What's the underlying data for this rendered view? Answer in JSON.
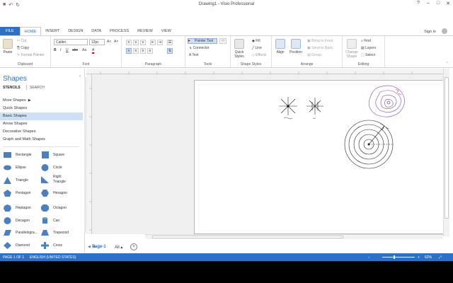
{
  "window": {
    "title": "Drawing1 - Visio Professional",
    "controls": [
      "?",
      "–",
      "□",
      "✕"
    ],
    "signin": "Sign in"
  },
  "qat": {
    "save": "■",
    "undo": "↶",
    "redo": "↻"
  },
  "tabs": [
    "FILE",
    "HOME",
    "INSERT",
    "DESIGN",
    "DATA",
    "PROCESS",
    "REVIEW",
    "VIEW"
  ],
  "ribbon": {
    "clipboard": {
      "label": "Clipboard",
      "paste": "Paste",
      "cut": "Cut",
      "copy": "Copy",
      "format_painter": "Format Painter"
    },
    "font": {
      "label": "Font",
      "family": "Calibri",
      "size": "12pt.",
      "grow": "A˄",
      "shrink": "A˅",
      "bold": "B",
      "italic": "I",
      "underline": "U",
      "strike": "abc",
      "aa": "Aa",
      "color": "A"
    },
    "paragraph": {
      "label": "Paragraph"
    },
    "tools": {
      "label": "Tools",
      "pointer": "Pointer Tool",
      "connector": "Connector",
      "text": "Text"
    },
    "shape_styles": {
      "label": "Shape Styles",
      "quick_styles": "Quick Styles",
      "fill": "Fill",
      "line": "Line",
      "effects": "Effects"
    },
    "arrange": {
      "label": "Arrange",
      "align": "Align",
      "position": "Position",
      "bring_front": "Bring to Front",
      "send_back": "Send to Back",
      "group": "Group"
    },
    "editing": {
      "label": "Editing",
      "change_shape": "Change Shape",
      "find": "Find",
      "layers": "Layers",
      "select": "Select"
    }
  },
  "shapes_pane": {
    "title": "Shapes",
    "stencils_tab": "STENCILS",
    "search_tab": "SEARCH",
    "stencils": [
      "More Shapes",
      "Quick Shapes",
      "Basic Shapes",
      "Arrow Shapes",
      "Decorative Shapes",
      "Graph and Math Shapes"
    ],
    "selected_stencil": "Basic Shapes",
    "items": [
      {
        "name": "Rectangle",
        "icon": "rectangle"
      },
      {
        "name": "Square",
        "icon": "square"
      },
      {
        "name": "Ellipse",
        "icon": "ellipse"
      },
      {
        "name": "Circle",
        "icon": "circle"
      },
      {
        "name": "Triangle",
        "icon": "triangle"
      },
      {
        "name": "Right Triangle",
        "icon": "right-triangle"
      },
      {
        "name": "Pentagon",
        "icon": "pentagon"
      },
      {
        "name": "Hexagon",
        "icon": "hexagon"
      },
      {
        "name": "Heptagon",
        "icon": "heptagon"
      },
      {
        "name": "Octagon",
        "icon": "octagon"
      },
      {
        "name": "Decagon",
        "icon": "decagon"
      },
      {
        "name": "Can",
        "icon": "can"
      },
      {
        "name": "Parallelogra...",
        "icon": "parallelogram"
      },
      {
        "name": "Trapezoid",
        "icon": "trapezoid"
      },
      {
        "name": "Diamond",
        "icon": "diamond"
      },
      {
        "name": "Cross",
        "icon": "cross"
      }
    ]
  },
  "page_tabs": {
    "current": "Page-1",
    "all": "All",
    "add": "+"
  },
  "status": {
    "page": "PAGE 1 OF 1",
    "language": "ENGLISH (UNITED STATES)",
    "zoom": "62%"
  },
  "colors": {
    "accent": "#2b72c6",
    "selected": "#cde0f5",
    "shape_fill": "#4a7fc1"
  }
}
